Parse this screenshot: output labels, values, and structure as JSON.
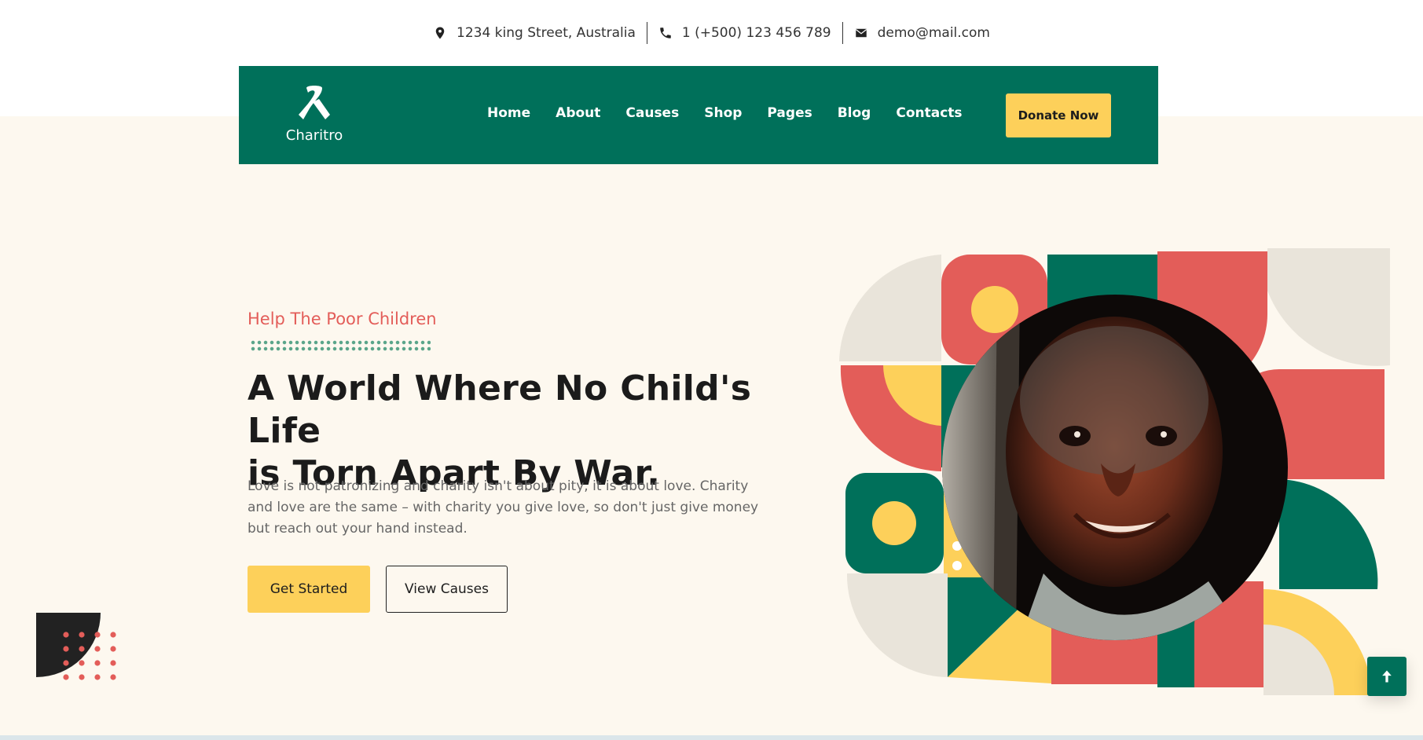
{
  "contact": {
    "address": "1234 king Street, Australia",
    "phone": "1 (+500) 123 456 789",
    "email": "demo@mail.com"
  },
  "brand": {
    "name": "Charitro"
  },
  "nav": {
    "items": [
      "Home",
      "About",
      "Causes",
      "Shop",
      "Pages",
      "Blog",
      "Contacts"
    ],
    "donate_label": "Donate Now"
  },
  "hero": {
    "subtitle": "Help The Poor Children",
    "title_line1": "A World Where No Child's Life",
    "title_line2": "is Torn Apart By War.",
    "body": "Love is not patronizing and charity isn't about pity, it is about love. Charity and love are the same – with charity you give love, so don't just give money but reach out your hand instead.",
    "cta_primary": "Get Started",
    "cta_secondary": "View Causes"
  },
  "colors": {
    "green": "#00705a",
    "yellow": "#fdd05a",
    "red": "#e35d59",
    "cream": "#fdf8ef",
    "beige": "#e9e4da"
  },
  "icons": {
    "address": "map-pin-icon",
    "phone": "phone-icon",
    "email": "envelope-icon",
    "scroll": "arrow-up-icon"
  }
}
